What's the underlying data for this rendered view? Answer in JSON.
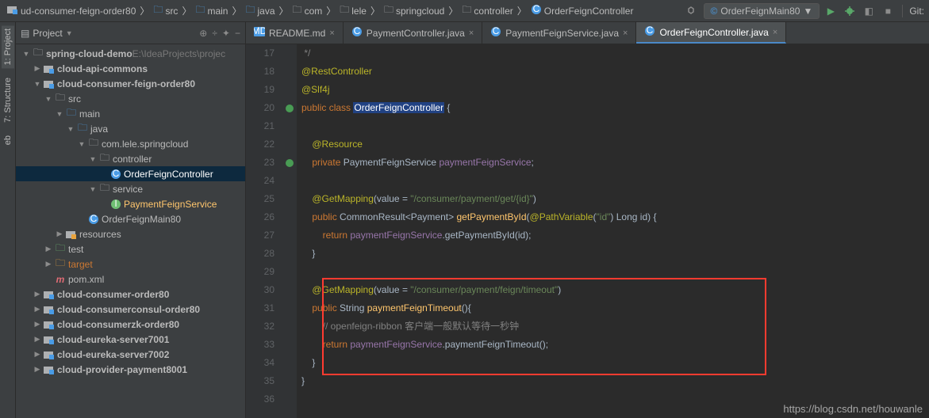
{
  "breadcrumbs": [
    {
      "icon": "module",
      "label": "ud-consumer-feign-order80"
    },
    {
      "icon": "folder-blue",
      "label": "src"
    },
    {
      "icon": "folder-blue",
      "label": "main"
    },
    {
      "icon": "folder-blue",
      "label": "java"
    },
    {
      "icon": "folder",
      "label": "com"
    },
    {
      "icon": "folder",
      "label": "lele"
    },
    {
      "icon": "folder",
      "label": "springcloud"
    },
    {
      "icon": "folder",
      "label": "controller"
    },
    {
      "icon": "class",
      "label": "OrderFeignController"
    }
  ],
  "run_config": {
    "icon": "class",
    "label": "OrderFeignMain80",
    "chev": "▼"
  },
  "toolbar": {
    "hammer": "⚒",
    "play": "▶",
    "bug": "🐞",
    "cover": "◧",
    "stop": "■",
    "git_label": "Git:"
  },
  "panel": {
    "title": "Project",
    "chev": "▼",
    "tools": [
      "⊕",
      "÷",
      "✦",
      "−"
    ]
  },
  "side_tabs": [
    {
      "label": "1: Project",
      "active": true
    },
    {
      "label": "7: Structure",
      "active": false
    },
    {
      "label": "eb",
      "active": false
    }
  ],
  "tree": [
    {
      "depth": 0,
      "arrow": "open",
      "icon": "folder",
      "label": "spring-cloud-demo",
      "suffix": "E:\\IdeaProjects\\projec",
      "bold": true
    },
    {
      "depth": 1,
      "arrow": "closed",
      "icon": "module",
      "label": "cloud-api-commons",
      "bold": true
    },
    {
      "depth": 1,
      "arrow": "open",
      "icon": "module",
      "label": "cloud-consumer-feign-order80",
      "bold": true
    },
    {
      "depth": 2,
      "arrow": "open",
      "icon": "folder",
      "label": "src"
    },
    {
      "depth": 3,
      "arrow": "open",
      "icon": "folder-blue",
      "label": "main"
    },
    {
      "depth": 4,
      "arrow": "open",
      "icon": "folder-blue",
      "label": "java"
    },
    {
      "depth": 5,
      "arrow": "open",
      "icon": "folder",
      "label": "com.lele.springcloud"
    },
    {
      "depth": 6,
      "arrow": "open",
      "icon": "folder",
      "label": "controller"
    },
    {
      "depth": 7,
      "arrow": "none",
      "icon": "class",
      "label": "OrderFeignController",
      "selected": true
    },
    {
      "depth": 6,
      "arrow": "open",
      "icon": "folder",
      "label": "service"
    },
    {
      "depth": 7,
      "arrow": "none",
      "icon": "interface",
      "label": "PaymentFeignService",
      "hl": true
    },
    {
      "depth": 5,
      "arrow": "none",
      "icon": "class",
      "label": "OrderFeignMain80"
    },
    {
      "depth": 3,
      "arrow": "closed",
      "icon": "folder-res",
      "label": "resources"
    },
    {
      "depth": 2,
      "arrow": "closed",
      "icon": "folder-green",
      "label": "test"
    },
    {
      "depth": 2,
      "arrow": "closed",
      "icon": "folder-orange",
      "label": "target",
      "orange": true
    },
    {
      "depth": 2,
      "arrow": "none",
      "icon": "maven",
      "label": "pom.xml"
    },
    {
      "depth": 1,
      "arrow": "closed",
      "icon": "module",
      "label": "cloud-consumer-order80",
      "bold": true
    },
    {
      "depth": 1,
      "arrow": "closed",
      "icon": "module",
      "label": "cloud-consumerconsul-order80",
      "bold": true
    },
    {
      "depth": 1,
      "arrow": "closed",
      "icon": "module",
      "label": "cloud-consumerzk-order80",
      "bold": true
    },
    {
      "depth": 1,
      "arrow": "closed",
      "icon": "module",
      "label": "cloud-eureka-server7001",
      "bold": true
    },
    {
      "depth": 1,
      "arrow": "closed",
      "icon": "module",
      "label": "cloud-eureka-server7002",
      "bold": true
    },
    {
      "depth": 1,
      "arrow": "closed",
      "icon": "module",
      "label": "cloud-provider-payment8001",
      "bold": true
    }
  ],
  "tabs": [
    {
      "icon": "md",
      "label": "README.md",
      "active": false
    },
    {
      "icon": "class",
      "label": "PaymentController.java",
      "active": false
    },
    {
      "icon": "class",
      "label": "PaymentFeignService.java",
      "active": false
    },
    {
      "icon": "class",
      "label": "OrderFeignController.java",
      "active": true
    }
  ],
  "line_start": 17,
  "lines": [
    {
      "n": 17,
      "html": " <span class='cm'>*/</span>"
    },
    {
      "n": 18,
      "html": "<span class='ann'>@RestController</span>"
    },
    {
      "n": 19,
      "html": "<span class='ann'>@Slf4j</span>"
    },
    {
      "n": 20,
      "mark": "dot",
      "html": "<span class='kw'>public class </span><span class='cursor-sel'>OrderFeignController</span><span class='txt'> {</span>"
    },
    {
      "n": 21,
      "html": ""
    },
    {
      "n": 22,
      "html": "    <span class='ann'>@Resource</span>"
    },
    {
      "n": 23,
      "mark": "dot",
      "html": "    <span class='kw'>private</span> <span class='type'>PaymentFeignService</span> <span class='field'>paymentFeignService</span><span class='txt'>;</span>"
    },
    {
      "n": 24,
      "html": ""
    },
    {
      "n": 25,
      "html": "    <span class='ann'>@GetMapping</span><span class='txt'>(</span><span class='type'>value</span> <span class='txt'>= </span><span class='str'>\"/consumer/payment/get/{id}\"</span><span class='txt'>)</span>"
    },
    {
      "n": 26,
      "html": "    <span class='kw'>public</span> <span class='type'>CommonResult&lt;Payment&gt;</span> <span class='fn'>getPaymentById</span><span class='txt'>(</span><span class='ann'>@PathVariable</span><span class='txt'>(</span><span class='str'>\"id\"</span><span class='txt'>)</span> <span class='type'>Long</span> <span class='txt'>id) {</span>"
    },
    {
      "n": 27,
      "html": "        <span class='kw'>return</span> <span class='field'>paymentFeignService</span><span class='txt'>.getPaymentById(id);</span>"
    },
    {
      "n": 28,
      "html": "    <span class='txt'>}</span>"
    },
    {
      "n": 29,
      "html": ""
    },
    {
      "n": 30,
      "html": "    <span class='ann'>@GetMapping</span><span class='txt'>(</span><span class='type'>value</span> <span class='txt'>= </span><span class='str'>\"/consumer/payment/feign/timeout\"</span><span class='txt'>)</span>"
    },
    {
      "n": 31,
      "html": "    <span class='kw'>public</span> <span class='type'>String</span> <span class='fn'>paymentFeignTimeout</span><span class='txt'>(){</span>"
    },
    {
      "n": 32,
      "html": "        <span class='cm'>// openfeign-ribbon 客户端一般默认等待一秒钟</span>"
    },
    {
      "n": 33,
      "html": "        <span class='kw'>return</span> <span class='field'>paymentFeignService</span><span class='txt'>.paymentFeignTimeout();</span>"
    },
    {
      "n": 34,
      "html": "    <span class='txt'>}</span>"
    },
    {
      "n": 35,
      "html": "<span class='txt'>}</span>"
    },
    {
      "n": 36,
      "html": ""
    }
  ],
  "red_box": {
    "top_line": 30,
    "bottom_line": 34
  },
  "watermark": "https://blog.csdn.net/houwanle"
}
